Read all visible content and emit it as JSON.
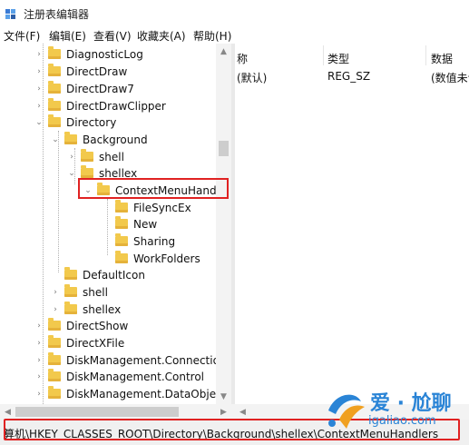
{
  "window": {
    "title": "注册表编辑器"
  },
  "menu": [
    "文件(F)",
    "编辑(E)",
    "查看(V)",
    "收藏夹(A)",
    "帮助(H)"
  ],
  "tree": [
    {
      "label": "DiagnosticLog",
      "expander": "›"
    },
    {
      "label": "DirectDraw",
      "expander": "›"
    },
    {
      "label": "DirectDraw7",
      "expander": "›"
    },
    {
      "label": "DirectDrawClipper",
      "expander": "›"
    },
    {
      "label": "Directory",
      "expander": "⌄"
    },
    {
      "label": "Background",
      "expander": "⌄"
    },
    {
      "label": "shell",
      "expander": "›"
    },
    {
      "label": "shellex",
      "expander": "⌄"
    },
    {
      "label": "ContextMenuHandle",
      "expander": "⌄"
    },
    {
      "label": "FileSyncEx",
      "expander": ""
    },
    {
      "label": "New",
      "expander": ""
    },
    {
      "label": "Sharing",
      "expander": ""
    },
    {
      "label": "WorkFolders",
      "expander": ""
    },
    {
      "label": "DefaultIcon",
      "expander": ""
    },
    {
      "label": "shell",
      "expander": "›"
    },
    {
      "label": "shellex",
      "expander": "›"
    },
    {
      "label": "DirectShow",
      "expander": "›"
    },
    {
      "label": "DirectXFile",
      "expander": "›"
    },
    {
      "label": "DiskManagement.Connection",
      "expander": "›"
    },
    {
      "label": "DiskManagement.Control",
      "expander": "›"
    },
    {
      "label": "DiskManagement.DataObject",
      "expander": "›"
    }
  ],
  "values": {
    "headers": [
      "称",
      "类型",
      "数据"
    ],
    "row": {
      "name": "(默认)",
      "type": "REG_SZ",
      "data": "(数值未设"
    }
  },
  "status": {
    "path": "算机\\HKEY_CLASSES_ROOT\\Directory\\Background\\shellex\\ContextMenuHandlers"
  },
  "watermark": {
    "title": "爱 · 尬聊",
    "url": "igaliao.com"
  },
  "colors": {
    "highlight": "#e02222",
    "folder": "#f2c94c",
    "watermark": "#2a84d6"
  }
}
